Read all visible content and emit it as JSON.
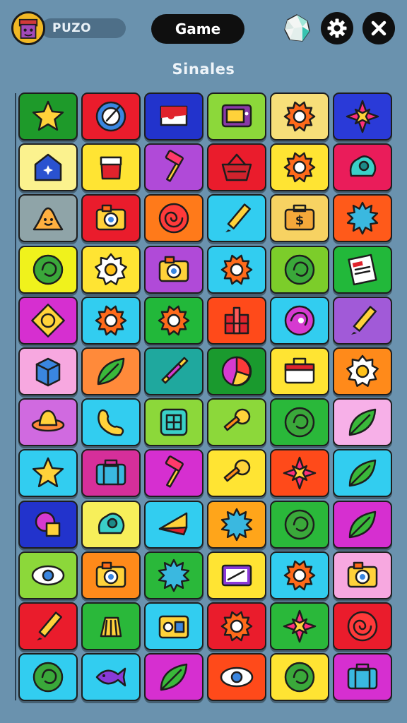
{
  "header": {
    "player_name": "PUZO",
    "mode_label": "Game",
    "board_title": "Sinales"
  },
  "colors": {
    "background": "#6a92ae",
    "icon_outline": "#1d1d1d"
  },
  "tiles": [
    {
      "color": "#1e9a2a",
      "icon": "star-icon"
    },
    {
      "color": "#ea1c2c",
      "icon": "compass-icon"
    },
    {
      "color": "#2233cc",
      "icon": "flag-icon"
    },
    {
      "color": "#8cd83a",
      "icon": "tv-icon"
    },
    {
      "color": "#f7df79",
      "icon": "gear-icon"
    },
    {
      "color": "#2a3ad8",
      "icon": "shuriken-icon"
    },
    {
      "color": "#fbf28e",
      "icon": "house-icon"
    },
    {
      "color": "#ffe433",
      "icon": "cup-icon"
    },
    {
      "color": "#b04ad8",
      "icon": "hammer-icon"
    },
    {
      "color": "#ea1c2c",
      "icon": "basket-icon"
    },
    {
      "color": "#ffe433",
      "icon": "gear-icon"
    },
    {
      "color": "#ea1c5a",
      "icon": "blob-icon"
    },
    {
      "color": "#8fa4a8",
      "icon": "slime-icon"
    },
    {
      "color": "#ea1c2c",
      "icon": "camera-icon"
    },
    {
      "color": "#ff7a1a",
      "icon": "spiral-icon"
    },
    {
      "color": "#32cdf0",
      "icon": "pencil-icon"
    },
    {
      "color": "#f7d262",
      "icon": "money-bag-icon"
    },
    {
      "color": "#ff5a1a",
      "icon": "splash-icon"
    },
    {
      "color": "#f0f21c",
      "icon": "swirl-icon"
    },
    {
      "color": "#ffe433",
      "icon": "egg-icon"
    },
    {
      "color": "#b04ad8",
      "icon": "camera-icon"
    },
    {
      "color": "#32cdf0",
      "icon": "gear-icon"
    },
    {
      "color": "#7ccd2a",
      "icon": "swirl-icon"
    },
    {
      "color": "#22b83a",
      "icon": "receipt-icon"
    },
    {
      "color": "#d62fd0",
      "icon": "diamond-icon"
    },
    {
      "color": "#32cdf0",
      "icon": "gear-icon"
    },
    {
      "color": "#22b83a",
      "icon": "gear-icon"
    },
    {
      "color": "#ff4a1a",
      "icon": "gift-icon"
    },
    {
      "color": "#32cdf0",
      "icon": "shell-icon"
    },
    {
      "color": "#a15ad8",
      "icon": "pencil-icon"
    },
    {
      "color": "#f7a8e0",
      "icon": "box-icon"
    },
    {
      "color": "#ff8a3a",
      "icon": "leaf-icon"
    },
    {
      "color": "#1fa89e",
      "icon": "sword-icon"
    },
    {
      "color": "#1a9a2e",
      "icon": "pie-icon"
    },
    {
      "color": "#ffe433",
      "icon": "toolbox-icon"
    },
    {
      "color": "#ff8a1a",
      "icon": "egg-icon"
    },
    {
      "color": "#d06ae0",
      "icon": "hat-icon"
    },
    {
      "color": "#32cdf0",
      "icon": "phone-icon"
    },
    {
      "color": "#8cd83a",
      "icon": "grid-icon"
    },
    {
      "color": "#8cd83a",
      "icon": "key-icon"
    },
    {
      "color": "#2ab83a",
      "icon": "swirl-icon"
    },
    {
      "color": "#f7b0e8",
      "icon": "leaf-icon"
    },
    {
      "color": "#32cdf0",
      "icon": "star-icon"
    },
    {
      "color": "#d62f9a",
      "icon": "suitcase-icon"
    },
    {
      "color": "#d62fd0",
      "icon": "hammer-icon"
    },
    {
      "color": "#ffe433",
      "icon": "key-icon"
    },
    {
      "color": "#ff4a1a",
      "icon": "shuriken-icon"
    },
    {
      "color": "#32cdf0",
      "icon": "leaf-icon"
    },
    {
      "color": "#2233cc",
      "icon": "candy-icon"
    },
    {
      "color": "#f7ef5a",
      "icon": "blob-icon"
    },
    {
      "color": "#32cdf0",
      "icon": "wedge-icon"
    },
    {
      "color": "#ffa51a",
      "icon": "splash-icon"
    },
    {
      "color": "#2ab83a",
      "icon": "swirl-icon"
    },
    {
      "color": "#d62fd0",
      "icon": "leaf-icon"
    },
    {
      "color": "#8cd83a",
      "icon": "eye-icon"
    },
    {
      "color": "#ff8a1a",
      "icon": "camera-icon"
    },
    {
      "color": "#2ab83a",
      "icon": "splash-icon"
    },
    {
      "color": "#ffe433",
      "icon": "tablet-icon"
    },
    {
      "color": "#32cdf0",
      "icon": "gear-icon"
    },
    {
      "color": "#f7a8e0",
      "icon": "camera-icon"
    },
    {
      "color": "#ea1c2c",
      "icon": "pencil-icon"
    },
    {
      "color": "#2ab83a",
      "icon": "fries-icon"
    },
    {
      "color": "#32cdf0",
      "icon": "radio-icon"
    },
    {
      "color": "#ea1c2c",
      "icon": "gear-icon"
    },
    {
      "color": "#2ab83a",
      "icon": "shuriken-icon"
    },
    {
      "color": "#ea1c2c",
      "icon": "spiral-icon"
    },
    {
      "color": "#32cdf0",
      "icon": "swirl-icon"
    },
    {
      "color": "#32cdf0",
      "icon": "fish-icon"
    },
    {
      "color": "#d62fd0",
      "icon": "leaf-icon"
    },
    {
      "color": "#ff4a1a",
      "icon": "eye-icon"
    },
    {
      "color": "#ffe433",
      "icon": "swirl-icon"
    },
    {
      "color": "#d62fd0",
      "icon": "suitcase-icon"
    }
  ]
}
